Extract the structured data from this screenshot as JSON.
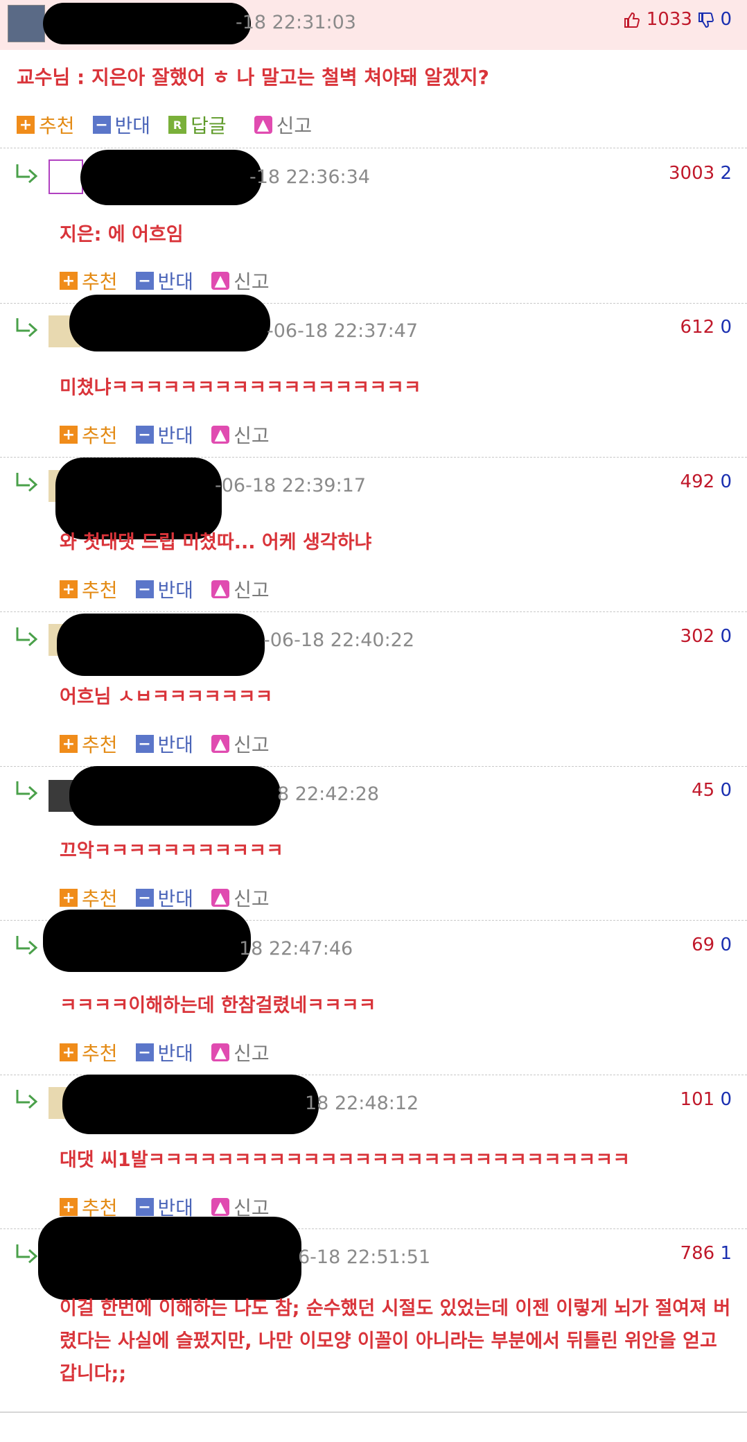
{
  "post": {
    "timestamp": "-18 22:31:03",
    "votes_up": "1033",
    "votes_down": "0",
    "title": "교수님 : 지은아 잘했어 ㅎ 나 말고는 철벽 쳐야돼 알겠지?",
    "actions": {
      "recommend": "추천",
      "oppose": "반대",
      "reply": "답글",
      "report": "신고"
    }
  },
  "comments": [
    {
      "timestamp": "-18 22:36:34",
      "up": "3003",
      "down": "2",
      "text": "지은: 에 어흐임"
    },
    {
      "timestamp": "-06-18 22:37:47",
      "up": "612",
      "down": "0",
      "text": "미쳤냐ㅋㅋㅋㅋㅋㅋㅋㅋㅋㅋㅋㅋㅋㅋㅋㅋㅋㅋ"
    },
    {
      "timestamp": "-06-18 22:39:17",
      "up": "492",
      "down": "0",
      "text": "와 첫대댓 드립 미쳤따... 어케 생각하냐"
    },
    {
      "timestamp": "-06-18 22:40:22",
      "up": "302",
      "down": "0",
      "text": "어흐님 ㅅㅂㅋㅋㅋㅋㅋㅋㅋ"
    },
    {
      "timestamp": "8 22:42:28",
      "up": "45",
      "down": "0",
      "text": "끄악ㅋㅋㅋㅋㅋㅋㅋㅋㅋㅋㅋ"
    },
    {
      "timestamp": "18 22:47:46",
      "up": "69",
      "down": "0",
      "text": "ㅋㅋㅋㅋ이해하는데 한참걸렸네ㅋㅋㅋㅋ"
    },
    {
      "timestamp": "18 22:48:12",
      "up": "101",
      "down": "0",
      "text": "대댓 씨1발ㅋㅋㅋㅋㅋㅋㅋㅋㅋㅋㅋㅋㅋㅋㅋㅋㅋㅋㅋㅋㅋㅋㅋㅋㅋㅋㅋㅋ"
    },
    {
      "timestamp": "6-18 22:51:51",
      "up": "786",
      "down": "1",
      "text": "이걸 한번에 이해하는 나도 참; 순수했던 시절도 있었는데 이젠 이렇게 뇌가 절여져 버렸다는 사실에 슬펐지만, 나만 이모양 이꼴이 아니라는 부분에서 뒤틀린 위안을 얻고 갑니다;;"
    }
  ],
  "comment_actions": {
    "recommend": "추천",
    "oppose": "반대",
    "report": "신고"
  },
  "colors": {
    "accent_red": "#d9343a",
    "vote_up": "#c0182a",
    "vote_down": "#1a2fb0",
    "header_bg": "#fde8e8"
  },
  "icons": {
    "thumb_up": "thumbs-up-icon",
    "thumb_down": "thumbs-down-icon",
    "reply": "reply-arrow-icon",
    "report": "siren-icon"
  }
}
